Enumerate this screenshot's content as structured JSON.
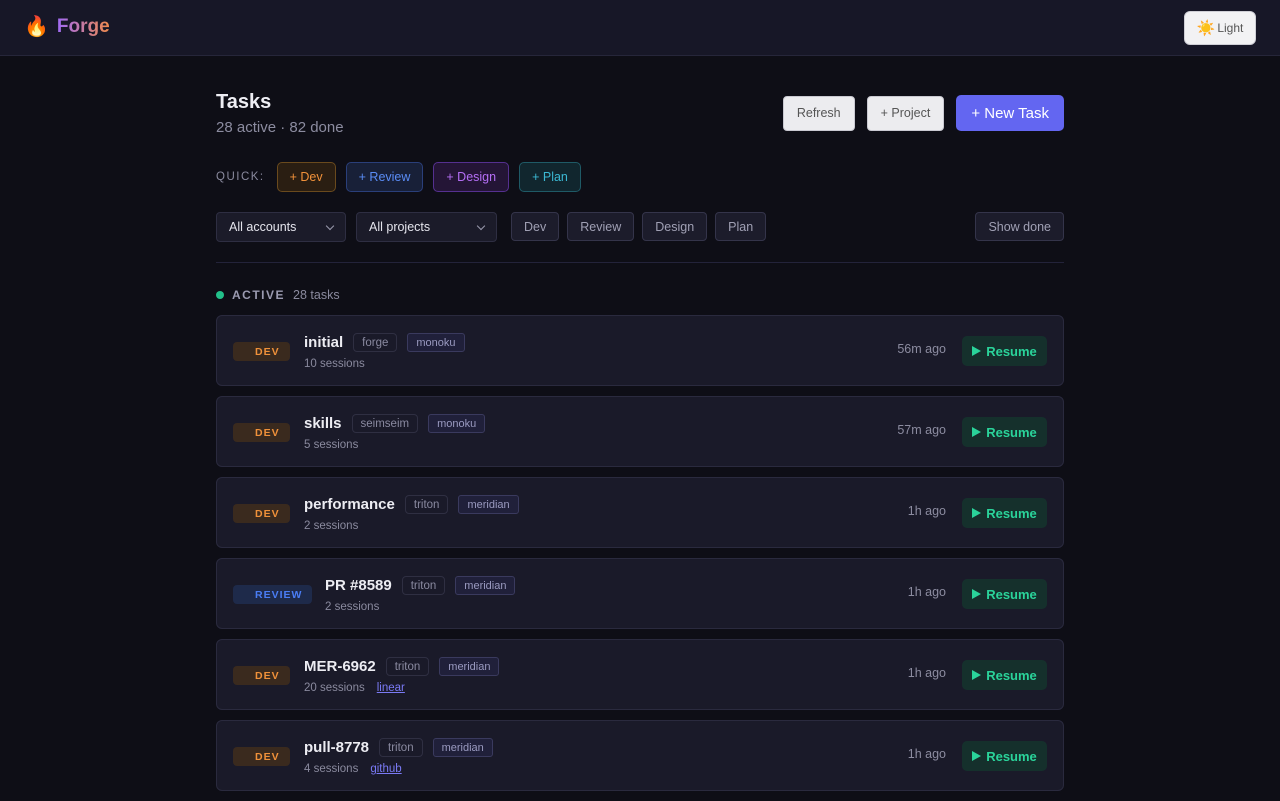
{
  "app": {
    "name": "Forge",
    "icon": "flame-icon"
  },
  "theme_toggle": {
    "icon": "sun-icon",
    "label": "Light"
  },
  "page": {
    "title": "Tasks",
    "subtitle": "28 active · 82 done"
  },
  "actions": {
    "refresh": "Refresh",
    "project": "+ Project",
    "new_task": "+ New Task"
  },
  "quick": {
    "label": "QUICK:",
    "items": [
      {
        "label": "+ Dev",
        "color": "#f0913a"
      },
      {
        "label": "+ Review",
        "color": "#5a8cf5"
      },
      {
        "label": "+ Design",
        "color": "#b46ef5"
      },
      {
        "label": "+ Plan",
        "color": "#3bb8d3"
      }
    ]
  },
  "filters": {
    "account": "All accounts",
    "project": "All projects",
    "types": [
      "Dev",
      "Review",
      "Design",
      "Plan"
    ],
    "show_done": "Show done"
  },
  "section": {
    "title": "ACTIVE",
    "count": "28 tasks",
    "color": "#22c08a"
  },
  "tasks": [
    {
      "type": "DEV",
      "name": "initial",
      "account": "forge",
      "project": "monoku",
      "sessions": "10 sessions",
      "link": "",
      "time": "56m ago",
      "action": "Resume"
    },
    {
      "type": "DEV",
      "name": "skills",
      "account": "seimseim",
      "project": "monoku",
      "sessions": "5 sessions",
      "link": "",
      "time": "57m ago",
      "action": "Resume"
    },
    {
      "type": "DEV",
      "name": "performance",
      "account": "triton",
      "project": "meridian",
      "sessions": "2 sessions",
      "link": "",
      "time": "1h ago",
      "action": "Resume"
    },
    {
      "type": "REVIEW",
      "name": "PR #8589",
      "account": "triton",
      "project": "meridian",
      "sessions": "2 sessions",
      "link": "",
      "time": "1h ago",
      "action": "Resume"
    },
    {
      "type": "DEV",
      "name": "MER-6962",
      "account": "triton",
      "project": "meridian",
      "sessions": "20 sessions",
      "link": "linear",
      "time": "1h ago",
      "action": "Resume"
    },
    {
      "type": "DEV",
      "name": "pull-8778",
      "account": "triton",
      "project": "meridian",
      "sessions": "4 sessions",
      "link": "github",
      "time": "1h ago",
      "action": "Resume"
    }
  ]
}
